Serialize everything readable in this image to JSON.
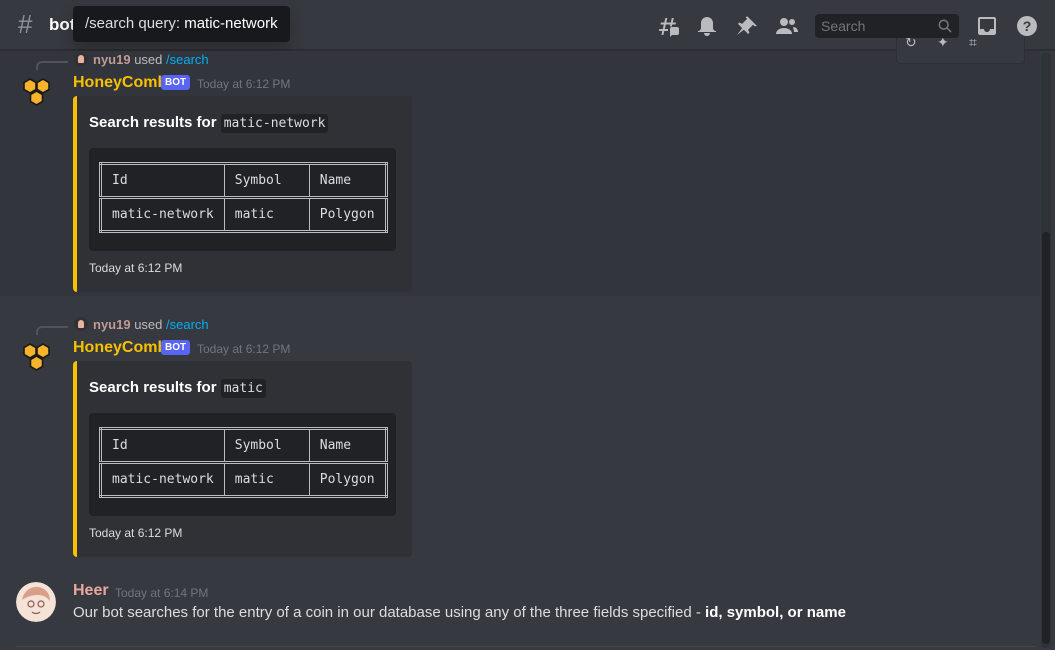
{
  "header": {
    "channel_name": "bot",
    "tooltip": {
      "prefix": "/search query:",
      "value": "matic-network"
    },
    "search_placeholder": "Search",
    "icons": [
      "threads-icon",
      "bell-icon",
      "pin-icon",
      "members-icon",
      "inbox-icon",
      "help-icon"
    ]
  },
  "colors": {
    "embed_accent": "#f8c100",
    "bot_tag": "#5865f2",
    "command_link": "#00aff4",
    "username_bot": "#f8c100"
  },
  "messages": [
    {
      "reply": {
        "user": "nyu19",
        "used": "used",
        "command": "/search"
      },
      "author": "HoneyComb",
      "bot_tag": "BOT",
      "timestamp": "Today at 6:12 PM",
      "embed": {
        "title_prefix": "Search results for",
        "query": "matic-network",
        "table": {
          "headers": [
            "Id",
            "Symbol",
            "Name"
          ],
          "rows": [
            [
              "matic-network",
              "matic",
              "Polygon"
            ]
          ]
        },
        "footer": "Today at 6:12 PM"
      }
    },
    {
      "reply": {
        "user": "nyu19",
        "used": "used",
        "command": "/search"
      },
      "author": "HoneyComb",
      "bot_tag": "BOT",
      "timestamp": "Today at 6:12 PM",
      "embed": {
        "title_prefix": "Search results for",
        "query": "matic",
        "table": {
          "headers": [
            "Id",
            "Symbol",
            "Name"
          ],
          "rows": [
            [
              "matic-network",
              "matic",
              "Polygon"
            ]
          ]
        },
        "footer": "Today at 6:12 PM"
      }
    },
    {
      "author": "Heer",
      "timestamp": "Today at 6:14 PM",
      "text": "Our bot searches for the entry of a coin in our database using any of the three fields specified -",
      "text_bold": "id, symbol, or name"
    }
  ]
}
